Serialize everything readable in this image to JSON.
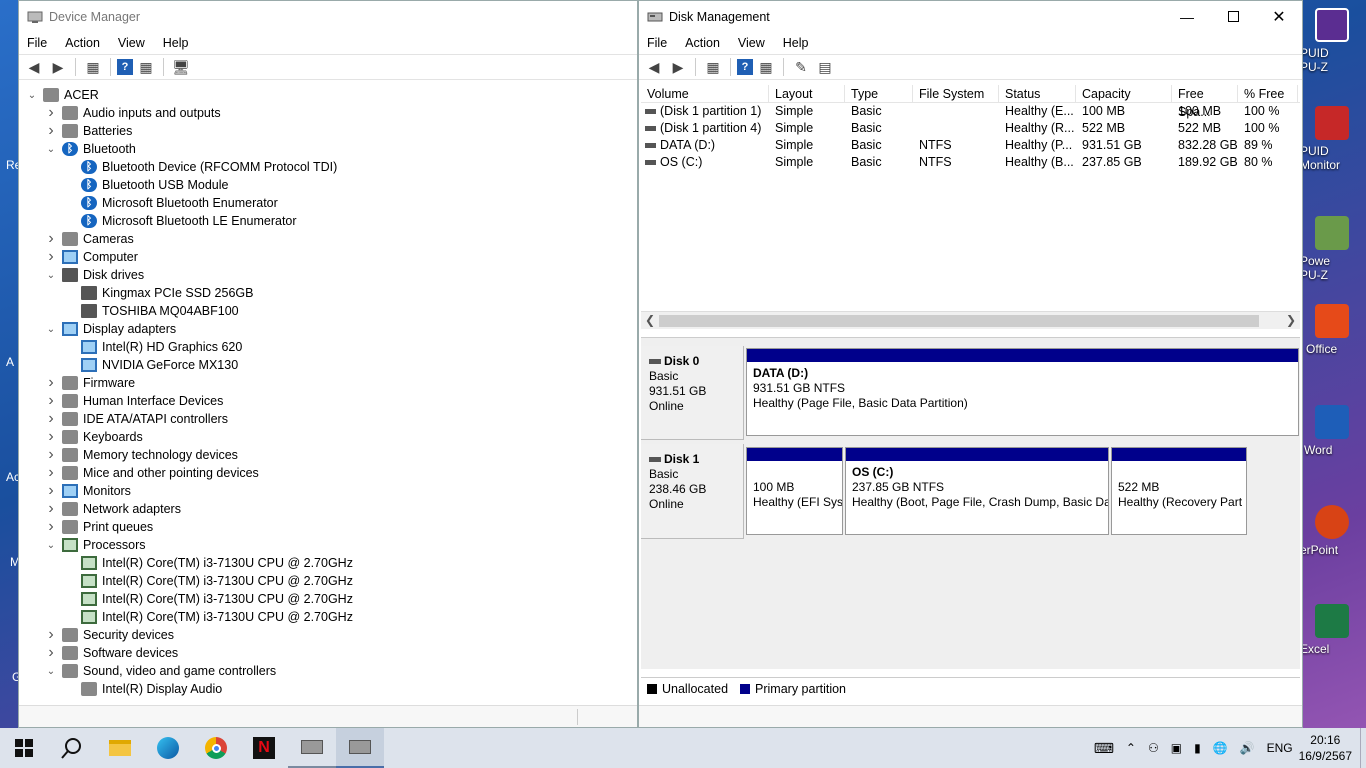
{
  "desktop": {
    "left_partial": [
      "Re",
      "A",
      "Ac",
      "M",
      "G"
    ],
    "right_icons": [
      "PUID\nPU-Z",
      "PUID\nMonitor",
      "Powe\nPU-Z",
      "Office",
      "Word",
      "erPoint",
      "Excel"
    ]
  },
  "device_manager": {
    "title": "Device Manager",
    "menu": [
      "File",
      "Action",
      "View",
      "Help"
    ],
    "tree": [
      {
        "label": "ACER",
        "level": 0,
        "state": "expanded",
        "icon": "computer-icon"
      },
      {
        "label": "Audio inputs and outputs",
        "level": 1,
        "state": "collapsed",
        "icon": "speaker-icon"
      },
      {
        "label": "Batteries",
        "level": 1,
        "state": "collapsed",
        "icon": "battery-icon"
      },
      {
        "label": "Bluetooth",
        "level": 1,
        "state": "expanded",
        "icon": "bluetooth-icon"
      },
      {
        "label": "Bluetooth Device (RFCOMM Protocol TDI)",
        "level": 2,
        "state": "leaf",
        "icon": "bluetooth-icon"
      },
      {
        "label": "Bluetooth USB Module",
        "level": 2,
        "state": "leaf",
        "icon": "bluetooth-icon"
      },
      {
        "label": "Microsoft Bluetooth Enumerator",
        "level": 2,
        "state": "leaf",
        "icon": "bluetooth-icon"
      },
      {
        "label": "Microsoft Bluetooth LE Enumerator",
        "level": 2,
        "state": "leaf",
        "icon": "bluetooth-icon"
      },
      {
        "label": "Cameras",
        "level": 1,
        "state": "collapsed",
        "icon": "camera-icon"
      },
      {
        "label": "Computer",
        "level": 1,
        "state": "collapsed",
        "icon": "monitor-icon"
      },
      {
        "label": "Disk drives",
        "level": 1,
        "state": "expanded",
        "icon": "drive-icon"
      },
      {
        "label": "Kingmax PCIe SSD 256GB",
        "level": 2,
        "state": "leaf",
        "icon": "drive-icon"
      },
      {
        "label": "TOSHIBA MQ04ABF100",
        "level": 2,
        "state": "leaf",
        "icon": "drive-icon"
      },
      {
        "label": "Display adapters",
        "level": 1,
        "state": "expanded",
        "icon": "monitor-icon"
      },
      {
        "label": "Intel(R) HD Graphics 620",
        "level": 2,
        "state": "leaf",
        "icon": "monitor-icon"
      },
      {
        "label": "NVIDIA GeForce MX130",
        "level": 2,
        "state": "leaf",
        "icon": "monitor-icon"
      },
      {
        "label": "Firmware",
        "level": 1,
        "state": "collapsed",
        "icon": "firmware-icon"
      },
      {
        "label": "Human Interface Devices",
        "level": 1,
        "state": "collapsed",
        "icon": "hid-icon"
      },
      {
        "label": "IDE ATA/ATAPI controllers",
        "level": 1,
        "state": "collapsed",
        "icon": "controller-icon"
      },
      {
        "label": "Keyboards",
        "level": 1,
        "state": "collapsed",
        "icon": "keyboard-icon"
      },
      {
        "label": "Memory technology devices",
        "level": 1,
        "state": "collapsed",
        "icon": "memory-icon"
      },
      {
        "label": "Mice and other pointing devices",
        "level": 1,
        "state": "collapsed",
        "icon": "mouse-icon"
      },
      {
        "label": "Monitors",
        "level": 1,
        "state": "collapsed",
        "icon": "monitor-icon"
      },
      {
        "label": "Network adapters",
        "level": 1,
        "state": "collapsed",
        "icon": "network-icon"
      },
      {
        "label": "Print queues",
        "level": 1,
        "state": "collapsed",
        "icon": "printer-icon"
      },
      {
        "label": "Processors",
        "level": 1,
        "state": "expanded",
        "icon": "chip-icon"
      },
      {
        "label": "Intel(R) Core(TM) i3-7130U CPU @ 2.70GHz",
        "level": 2,
        "state": "leaf",
        "icon": "chip-icon"
      },
      {
        "label": "Intel(R) Core(TM) i3-7130U CPU @ 2.70GHz",
        "level": 2,
        "state": "leaf",
        "icon": "chip-icon"
      },
      {
        "label": "Intel(R) Core(TM) i3-7130U CPU @ 2.70GHz",
        "level": 2,
        "state": "leaf",
        "icon": "chip-icon"
      },
      {
        "label": "Intel(R) Core(TM) i3-7130U CPU @ 2.70GHz",
        "level": 2,
        "state": "leaf",
        "icon": "chip-icon"
      },
      {
        "label": "Security devices",
        "level": 1,
        "state": "collapsed",
        "icon": "security-icon"
      },
      {
        "label": "Software devices",
        "level": 1,
        "state": "collapsed",
        "icon": "software-icon"
      },
      {
        "label": "Sound, video and game controllers",
        "level": 1,
        "state": "expanded",
        "icon": "speaker-icon"
      },
      {
        "label": "Intel(R) Display Audio",
        "level": 2,
        "state": "leaf",
        "icon": "speaker-icon"
      }
    ]
  },
  "disk_management": {
    "title": "Disk Management",
    "menu": [
      "File",
      "Action",
      "View",
      "Help"
    ],
    "columns": [
      "Volume",
      "Layout",
      "Type",
      "File System",
      "Status",
      "Capacity",
      "Free Spa...",
      "% Free"
    ],
    "volumes": [
      [
        "(Disk 1 partition 1)",
        "Simple",
        "Basic",
        "",
        "Healthy (E...",
        "100 MB",
        "100 MB",
        "100 %"
      ],
      [
        "(Disk 1 partition 4)",
        "Simple",
        "Basic",
        "",
        "Healthy (R...",
        "522 MB",
        "522 MB",
        "100 %"
      ],
      [
        "DATA (D:)",
        "Simple",
        "Basic",
        "NTFS",
        "Healthy (P...",
        "931.51 GB",
        "832.28 GB",
        "89 %"
      ],
      [
        "OS (C:)",
        "Simple",
        "Basic",
        "NTFS",
        "Healthy (B...",
        "237.85 GB",
        "189.92 GB",
        "80 %"
      ]
    ],
    "disk0": {
      "name": "Disk 0",
      "type": "Basic",
      "size": "931.51 GB",
      "status": "Online",
      "partition": {
        "title": "DATA  (D:)",
        "line1": "931.51 GB NTFS",
        "line2": "Healthy (Page File, Basic Data Partition)"
      }
    },
    "disk1": {
      "name": "Disk 1",
      "type": "Basic",
      "size": "238.46 GB",
      "status": "Online",
      "partitions": [
        {
          "title": "",
          "line1": "100 MB",
          "line2": "Healthy (EFI Sys"
        },
        {
          "title": "OS  (C:)",
          "line1": "237.85 GB NTFS",
          "line2": "Healthy (Boot, Page File, Crash Dump, Basic Dat"
        },
        {
          "title": "",
          "line1": "522 MB",
          "line2": "Healthy (Recovery Part"
        }
      ]
    },
    "legend": {
      "unallocated": "Unallocated",
      "primary": "Primary partition"
    },
    "colors": {
      "primary": "#00008b",
      "unallocated": "#000000"
    }
  },
  "taskbar": {
    "language": "ENG",
    "time": "20:16",
    "date": "16/9/2567"
  }
}
